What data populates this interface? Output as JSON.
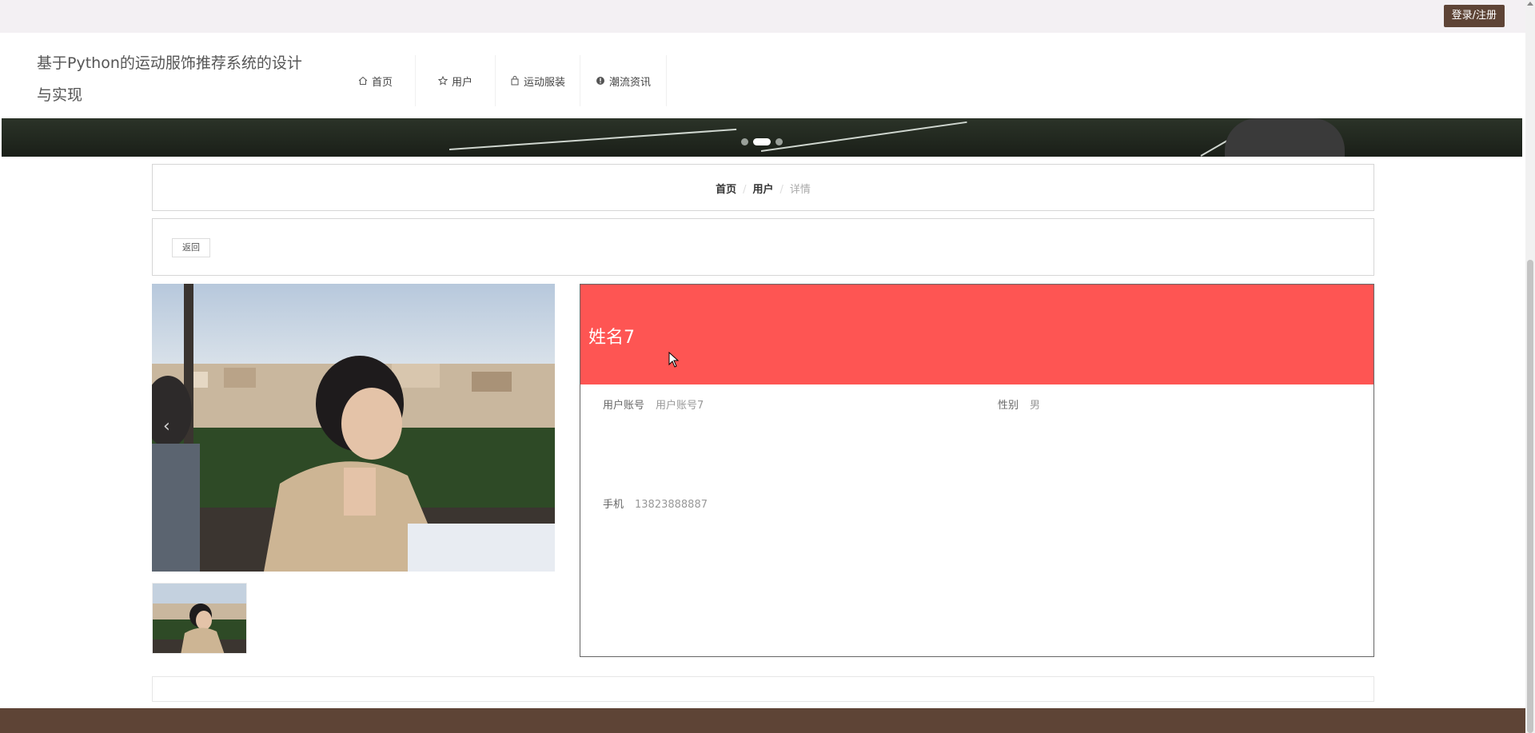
{
  "topbar": {
    "login_label": "登录/注册"
  },
  "header": {
    "site_title": "基于Python的运动服饰推荐系统的设计与实现",
    "nav": [
      {
        "label": "首页",
        "icon": "home-icon"
      },
      {
        "label": "用户",
        "icon": "star-icon"
      },
      {
        "label": "运动服装",
        "icon": "bag-icon"
      },
      {
        "label": "潮流资讯",
        "icon": "info-icon"
      }
    ]
  },
  "breadcrumb": {
    "home": "首页",
    "user": "用户",
    "current": "详情",
    "separator": "/"
  },
  "actions": {
    "back_label": "返回"
  },
  "detail": {
    "name": "姓名7",
    "fields": {
      "account": {
        "label": "用户账号",
        "value": "用户账号7"
      },
      "gender": {
        "label": "性别",
        "value": "男"
      },
      "phone": {
        "label": "手机",
        "value": "13823888887"
      }
    }
  },
  "colors": {
    "accent": "#fe5553",
    "brand_brown": "#5e4436",
    "topbar_bg": "#f3f0f3"
  }
}
